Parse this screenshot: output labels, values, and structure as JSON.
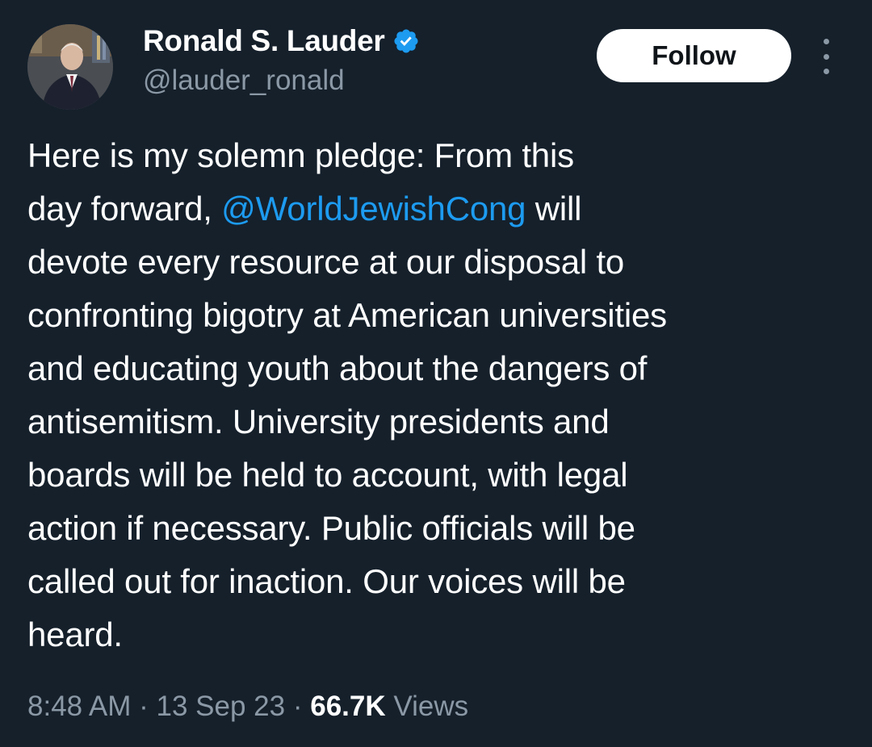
{
  "author": {
    "display_name": "Ronald S. Lauder",
    "handle": "@lauder_ronald",
    "verified": true,
    "verified_color": "#1d9bf0"
  },
  "actions": {
    "follow_label": "Follow",
    "more_icon": "more-vertical-icon"
  },
  "tweet": {
    "lines": [
      {
        "text": "Here is my solemn pledge: From this"
      },
      {
        "pre": "day forward, ",
        "mention": "@WorldJewishCong",
        "post": " will"
      },
      {
        "text": "devote every resource at our disposal to"
      },
      {
        "text": "confronting bigotry at American universities"
      },
      {
        "text": "and educating youth about the dangers of"
      },
      {
        "text": "antisemitism. University presidents and"
      },
      {
        "text": "boards will be held to account, with legal"
      },
      {
        "text": "action if necessary. Public officials will be"
      },
      {
        "text": "called out for inaction. Our voices will be"
      },
      {
        "text": "heard."
      }
    ]
  },
  "meta": {
    "time": "8:48 AM",
    "separator": " · ",
    "date": "13 Sep 23",
    "views_count": "66.7K",
    "views_label": " Views"
  },
  "colors": {
    "background": "#15202b",
    "link": "#1d9bf0",
    "secondary_text": "#8b98a5"
  }
}
